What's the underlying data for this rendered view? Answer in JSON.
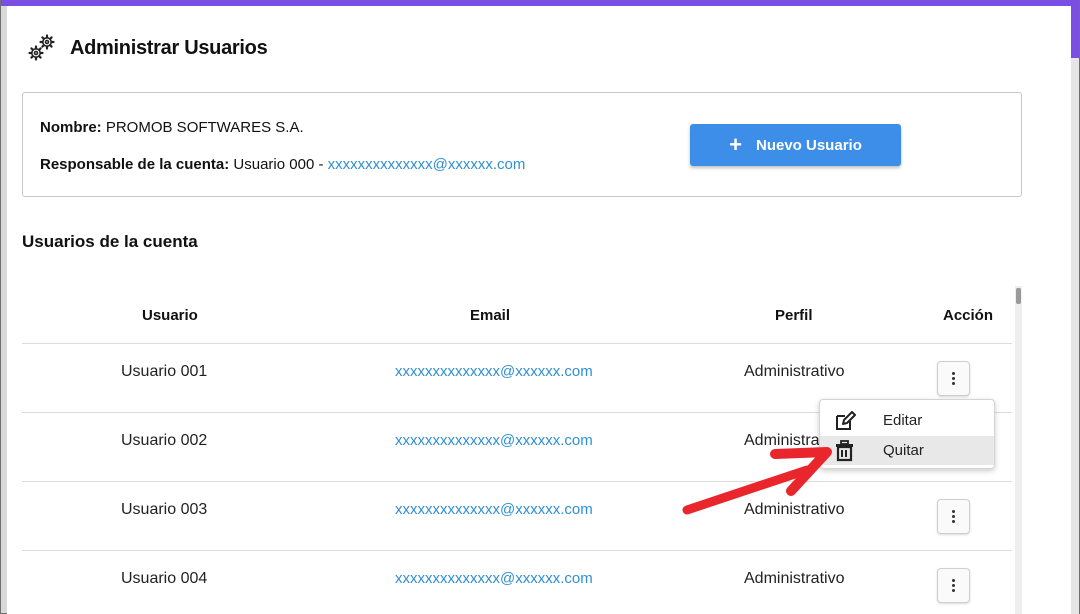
{
  "page": {
    "title": "Administrar Usuarios",
    "icon": "gears-icon",
    "accent_color": "#7a4de3"
  },
  "account": {
    "name_label": "Nombre:",
    "name_value": "PROMOB SOFTWARES S.A.",
    "owner_label": "Responsable de la cuenta:",
    "owner_user": "Usuario 000 -",
    "owner_email": "xxxxxxxxxxxxxx@xxxxxx.com",
    "new_user_button": "Nuevo Usuario",
    "button_color": "#3d8ee8"
  },
  "users_section": {
    "title": "Usuarios de la cuenta",
    "columns": [
      "Usuario",
      "Email",
      "Perfil",
      "Acción"
    ],
    "rows": [
      {
        "user": "Usuario 001",
        "email": "xxxxxxxxxxxxxx@xxxxxx.com",
        "profile": "Administrativo"
      },
      {
        "user": "Usuario 002",
        "email": "xxxxxxxxxxxxxx@xxxxxx.com",
        "profile": "Administrativo"
      },
      {
        "user": "Usuario 003",
        "email": "xxxxxxxxxxxxxx@xxxxxx.com",
        "profile": "Administrativo"
      },
      {
        "user": "Usuario 004",
        "email": "xxxxxxxxxxxxxx@xxxxxx.com",
        "profile": "Administrativo"
      }
    ]
  },
  "action_menu": {
    "items": [
      {
        "label": "Editar",
        "icon": "edit-icon"
      },
      {
        "label": "Quitar",
        "icon": "trash-icon"
      }
    ]
  },
  "annotation": {
    "arrow_color": "#e8262b"
  }
}
